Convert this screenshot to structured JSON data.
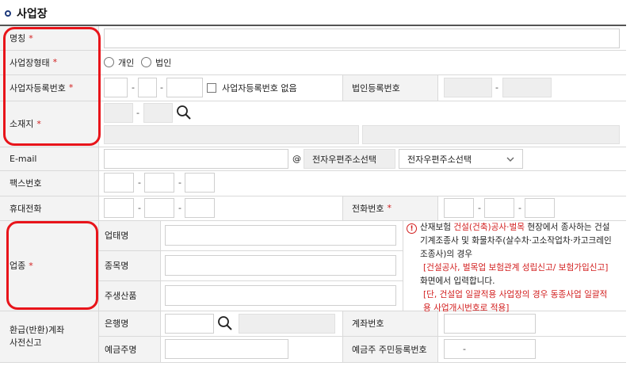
{
  "section": {
    "title": "사업장"
  },
  "fields": {
    "name": {
      "label": "명칭",
      "req": "*"
    },
    "biz_type": {
      "label": "사업장형태",
      "req": "*",
      "options": [
        "개인",
        "법인"
      ]
    },
    "biz_reg_no": {
      "label": "사업자등록번호",
      "req": "*",
      "none_label": "사업자등록번호 없음"
    },
    "corp_reg_no": {
      "label": "법인등록번호"
    },
    "address": {
      "label": "소재지",
      "req": "*"
    },
    "email": {
      "label": "E-mail",
      "at": "@",
      "domain_placeholder": "전자우편주소선택",
      "select_value": "전자우편주소선택"
    },
    "fax": {
      "label": "팩스번호"
    },
    "mobile": {
      "label": "휴대전화"
    },
    "phone": {
      "label": "전화번호",
      "req": "*"
    },
    "industry": {
      "label": "업종",
      "req": "*",
      "type_label": "업태명",
      "kind_label": "종목명",
      "product_label": "주생산품"
    },
    "refund": {
      "label_line1": "환급(반환)계좌",
      "label_line2": "사전신고",
      "bank_label": "은행명",
      "account_label": "계좌번호",
      "holder_label": "예금주명",
      "holder_id_label": "예금주 주민등록번호",
      "holder_id_dash": "-"
    },
    "dash": "-"
  },
  "notice": {
    "l1a": "산재보험 ",
    "l1b": "건설(건축)공사·벌목",
    "l1c": " 현장에서 종사하는 건설",
    "l2": "기계조종사 및 화물차주(살수차·고소작업차·카고크레인",
    "l3": "조종사)의 경우",
    "l4": "[건설공사, 벌목업 보험관계 성립신고/ 보험가입신고]",
    "l5": "화면에서 입력합니다.",
    "l6": "[단, 건설업 일괄적용 사업장의 경우 동종사업 일괄적",
    "l7": "용 사업개시번호로 적용]"
  },
  "icons": {
    "section": "section-bullet-icon",
    "search": "magnifier-icon",
    "warn": "exclamation-circle-icon",
    "select": "chevron-down-icon"
  },
  "colors": {
    "required": "#d21d1d",
    "highlight": "#e8141a",
    "label_bg": "#f3f3f3",
    "disabled": "#eeeeee"
  }
}
